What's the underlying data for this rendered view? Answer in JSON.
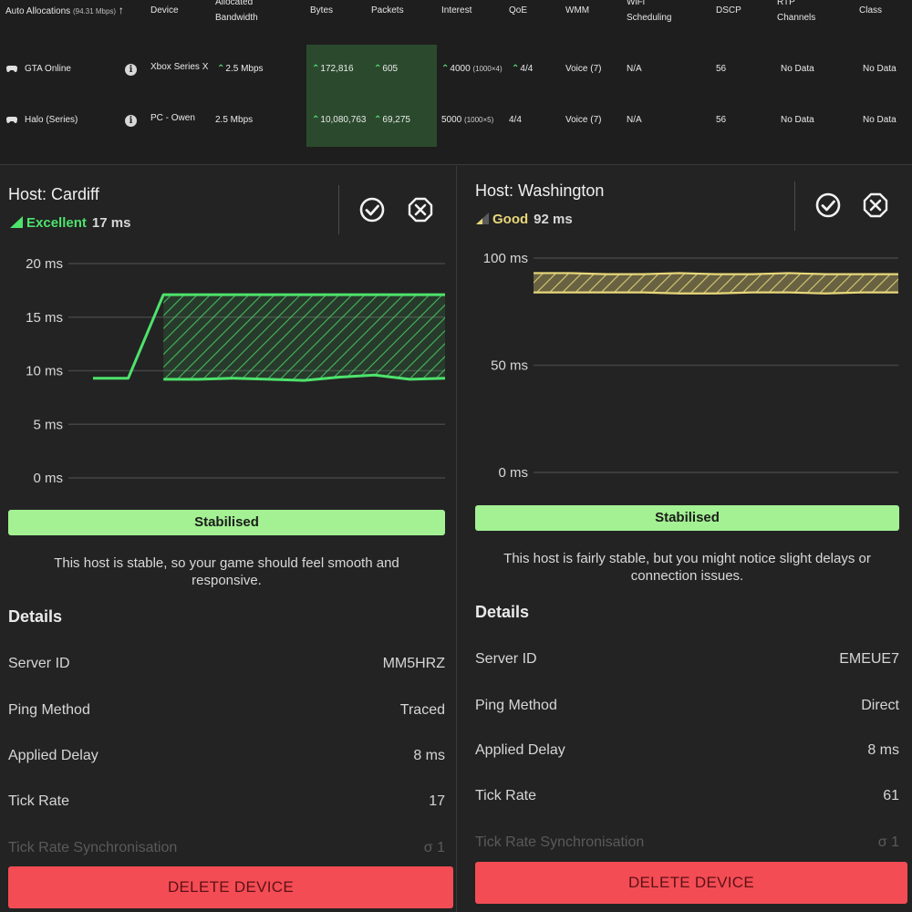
{
  "table": {
    "headers": {
      "auto_allocations": "Auto Allocations",
      "auto_allocations_sub": "(94.31 Mbps)",
      "device": "Device",
      "allocated_bandwidth_1": "Allocated",
      "allocated_bandwidth_2": "Bandwidth",
      "bytes": "Bytes",
      "packets": "Packets",
      "interest": "Interest",
      "qoe": "QoE",
      "wmm": "WMM",
      "wifi_1": "WiFi",
      "wifi_2": "Scheduling",
      "dscp": "DSCP",
      "rtp_1": "RTP",
      "rtp_2": "Channels",
      "class": "Class"
    },
    "rows": [
      {
        "name": "GTA Online",
        "info": "i",
        "device": "Xbox Series X",
        "bandwidth": "2.5 Mbps",
        "bytes": "172,816",
        "packets": "605",
        "interest": "4000",
        "interest_sub": "(1000×4)",
        "qoe": "4/4",
        "wmm": "Voice (7)",
        "wifi": "N/A",
        "dscp": "56",
        "rtp": "No Data",
        "class": "No Data"
      },
      {
        "name": "Halo (Series)",
        "info": "i",
        "device": "PC - Owen",
        "bandwidth": "2.5 Mbps",
        "bytes": "10,080,763",
        "packets": "69,275",
        "interest": "5000",
        "interest_sub": "(1000×5)",
        "qoe": "4/4",
        "wmm": "Voice (7)",
        "wifi": "N/A",
        "dscp": "56",
        "rtp": "No Data",
        "class": "No Data"
      }
    ]
  },
  "hosts": [
    {
      "title": "Host: Cardiff",
      "quality": "Excellent",
      "quality_color": "#4de36c",
      "ping": "17 ms",
      "status": "Stabilised",
      "description": "This host is stable, so your game should feel smooth and responsive.",
      "details_title": "Details",
      "details": [
        {
          "label": "Server ID",
          "value": "MM5HRZ"
        },
        {
          "label": "Ping Method",
          "value": "Traced"
        },
        {
          "label": "Applied Delay",
          "value": "8 ms"
        },
        {
          "label": "Tick Rate",
          "value": "17"
        },
        {
          "label": "Tick Rate Synchronisation",
          "value": "σ 1"
        }
      ],
      "delete_label": "DELETE DEVICE"
    },
    {
      "title": "Host: Washington",
      "quality": "Good",
      "quality_color": "#e8d77a",
      "ping": "92 ms",
      "status": "Stabilised",
      "description": "This host is fairly stable, but you might notice slight delays or connection issues.",
      "details_title": "Details",
      "details": [
        {
          "label": "Server ID",
          "value": "EMEUE7"
        },
        {
          "label": "Ping Method",
          "value": "Direct"
        },
        {
          "label": "Applied Delay",
          "value": "8 ms"
        },
        {
          "label": "Tick Rate",
          "value": "61"
        },
        {
          "label": "Tick Rate Synchronisation",
          "value": "σ 1"
        }
      ],
      "delete_label": "DELETE DEVICE"
    }
  ],
  "chart_data": [
    {
      "type": "area",
      "y_ticks": [
        "0 ms",
        "5 ms",
        "10 ms",
        "15 ms",
        "20 ms"
      ],
      "ylim": [
        0,
        20
      ],
      "color": "#4de36c",
      "x": [
        0,
        1,
        2,
        3,
        4,
        5,
        6,
        7,
        8,
        9,
        10
      ],
      "series": [
        {
          "values": [
            9.3,
            9.3,
            17.1,
            17.1,
            17.1,
            17.1,
            17.1,
            17.1,
            17.1,
            17.1,
            17.1
          ]
        },
        {
          "values": [
            null,
            null,
            9.2,
            9.2,
            9.3,
            9.2,
            9.1,
            9.4,
            9.6,
            9.2,
            9.3
          ]
        }
      ]
    },
    {
      "type": "area",
      "y_ticks": [
        "0 ms",
        "50 ms",
        "100 ms"
      ],
      "ylim": [
        0,
        100
      ],
      "color": "#e8d77a",
      "x": [
        0,
        1,
        2,
        3,
        4,
        5,
        6,
        7,
        8,
        9,
        10
      ],
      "series": [
        {
          "values": [
            93,
            93,
            92.5,
            92.5,
            93,
            92.5,
            92.5,
            93,
            92.5,
            92.5,
            92.5
          ]
        },
        {
          "values": [
            84,
            84,
            84,
            84,
            83.5,
            83.5,
            84,
            84,
            83.5,
            84,
            84
          ]
        }
      ]
    }
  ]
}
